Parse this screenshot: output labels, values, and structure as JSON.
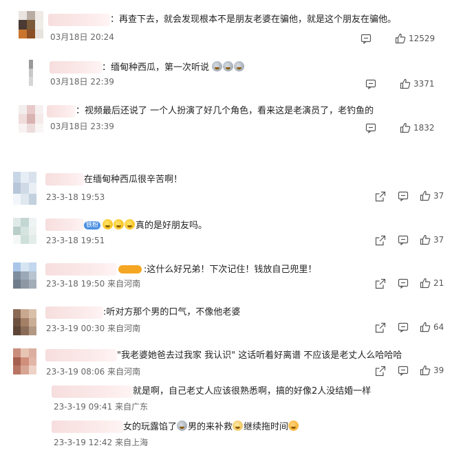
{
  "top_comments": [
    {
      "name_tail": "：",
      "text": "再查下去，就会发现根本不是朋友老婆在骗他，就是这个朋友在骗他。",
      "time": "03月18日 20:24",
      "likes": "12529",
      "avatar": [
        "#e9e4e0",
        "#b9aca3",
        "#efeae6",
        "#4a3a33",
        "#7b5a3a",
        "#f0ece8",
        "#c9752f",
        "#8a4f25",
        "#e7e2dd"
      ]
    },
    {
      "name_tail": "：",
      "text": "缅甸种西瓜，第一次听说",
      "time": "03月18日 22:39",
      "likes": "3371",
      "avatar": [
        "#ffffff",
        "#9a9a9a",
        "#ffffff",
        "#ffffff",
        "#c8c8c8",
        "#ffffff",
        "#ffffff",
        "#d6d6d6",
        "#ffffff"
      ]
    },
    {
      "name_tail": "：",
      "text": "视频最后还说了 一个人扮演了好几个角色，看来这是老演员了，老钓鱼的",
      "time": "03月18日 23:39",
      "likes": "1832",
      "avatar": [
        "#f3eeee",
        "#e8c9c9",
        "#f6f0f0",
        "#f1dcdc",
        "#d9b2b2",
        "#f5eaea",
        "#f8f2f2",
        "#eddcdc",
        "#faf5f5"
      ]
    }
  ],
  "comments": [
    {
      "prefix": "",
      "text": "在缅甸种西瓜很辛苦啊！",
      "time": "23-3-18 19:53",
      "location": "",
      "likes": "37",
      "avatar": [
        "#c9d6e6",
        "#e6edf5",
        "#d9e2ec",
        "#b7c6d8",
        "#cfdae6",
        "#e9eff5",
        "#f2f6fa",
        "#dfe7ef",
        "#c3d0de"
      ]
    },
    {
      "prefix": "铁粉",
      "badge_color": "#4a90e2",
      "emoji_count": 3,
      "text": "真的是好朋友吗。",
      "time": "23-3-18 19:51",
      "location": "",
      "likes": "37",
      "avatar": [
        "#dfe9e7",
        "#c4d6d2",
        "#eef4f3",
        "#b9cec8",
        "#d6e4e0",
        "#eaf1ef",
        "#f4f8f7",
        "#cfe0db",
        "#e2ece9"
      ]
    },
    {
      "prefix": "",
      "badge_color": "#f5a623",
      "text": ":这什么好兄弟！下次记住！钱放自己兜里！",
      "time": "23-3-18 19:50",
      "location": "来自河南",
      "likes": "21",
      "avatar": [
        "#a9c6e8",
        "#d7e5f3",
        "#c3d7ee",
        "#7e8e9f",
        "#9aa8b7",
        "#b8c4d0",
        "#6f7c8a",
        "#8d98a4",
        "#a3adb8"
      ]
    },
    {
      "prefix": "",
      "text": ":听对方那个男的口气，不像他老婆",
      "time": "23-3-19 00:30",
      "location": "来自河南",
      "likes": "64",
      "avatar": [
        "#8b6a55",
        "#c8a88f",
        "#d9c0aa",
        "#6e5240",
        "#a37f66",
        "#c9ad95",
        "#5e4636",
        "#8a6c58",
        "#b39883"
      ]
    },
    {
      "prefix": "",
      "text": "\"我老婆她爸去过我家 我认识\" 这话听着好离谱 不应该是老丈人么哈哈哈",
      "time": "23-3-19 08:06",
      "location": "来自河南",
      "likes": "39",
      "avatar": [
        "#c98e7c",
        "#e8c4b5",
        "#dcae9f",
        "#a5604f",
        "#cf8f7b",
        "#e2b6a6",
        "#b87563",
        "#d8a593",
        "#efd2c6"
      ]
    }
  ],
  "replies": [
    {
      "text": "就是啊，自己老丈人应该很熟悉啊，搞的好像2人没结婚一样",
      "time": "23-3-19 09:41",
      "location": "来自广东"
    },
    {
      "text_a": "女的玩露馅了",
      "text_b": "男的来补救",
      "text_c": "继续拖时间",
      "time": "23-3-19 12:42",
      "location": "来自上海"
    }
  ],
  "icons": {
    "share": "share-icon",
    "comment": "comment-icon",
    "like": "like-icon"
  },
  "colors": {
    "meta": "#666666",
    "badge_blue": "#4a90e2",
    "badge_orange": "#f5a623"
  }
}
